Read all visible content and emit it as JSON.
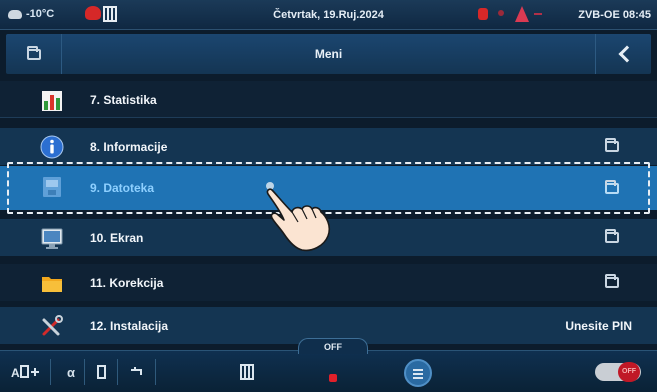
{
  "status_bar": {
    "temperature": "-10°C",
    "date": "Četvrtak, 19.Ruj.2024",
    "device": "ZVB-OE 08:45"
  },
  "header": {
    "title": "Meni"
  },
  "menu": {
    "items": [
      {
        "label": "7. Statistika",
        "icon": "statistics-icon"
      },
      {
        "label": "8. Informacije",
        "icon": "info-icon",
        "folder": true
      },
      {
        "label": "9. Datoteka",
        "icon": "file-icon",
        "folder": true,
        "selected": true
      },
      {
        "label": "10. Ekran",
        "icon": "screen-icon",
        "folder": true
      },
      {
        "label": "11. Korekcija",
        "icon": "correction-folder-icon",
        "folder": true
      },
      {
        "label": "12. Instalacija",
        "icon": "installation-tools-icon",
        "right_text": "Unesite PIN"
      }
    ]
  },
  "bottom_bar": {
    "off_label": "OFF",
    "toggle_label": "OFF"
  },
  "colors": {
    "selected_row": "#1f73b4",
    "accent_red": "#e0202a"
  }
}
